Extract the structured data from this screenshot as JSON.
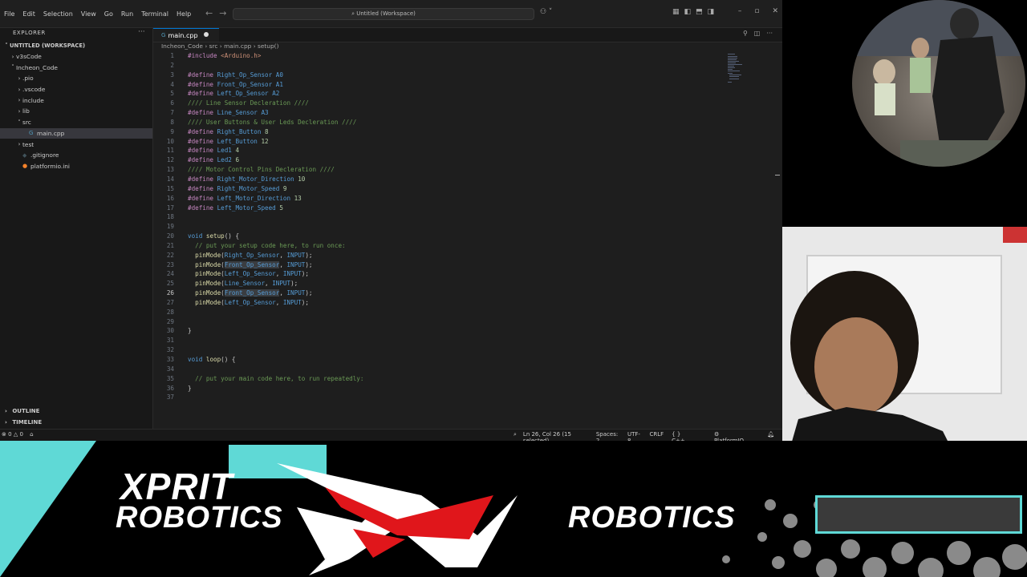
{
  "titlebar": {
    "menu": [
      "File",
      "Edit",
      "Selection",
      "View",
      "Go",
      "Run",
      "Terminal",
      "Help"
    ],
    "search_text": "Untitled (Workspace)"
  },
  "sidebar": {
    "header": "EXPLORER",
    "workspace": "UNTITLED (WORKSPACE)",
    "items": [
      {
        "label": "v3sCode",
        "depth": 1,
        "type": "folder"
      },
      {
        "label": "Incheon_Code",
        "depth": 1,
        "type": "folder-open"
      },
      {
        "label": ".pio",
        "depth": 2,
        "type": "folder"
      },
      {
        "label": ".vscode",
        "depth": 2,
        "type": "folder"
      },
      {
        "label": "include",
        "depth": 2,
        "type": "folder"
      },
      {
        "label": "lib",
        "depth": 2,
        "type": "folder"
      },
      {
        "label": "src",
        "depth": 2,
        "type": "folder-open"
      },
      {
        "label": "main.cpp",
        "depth": 3,
        "type": "cpp",
        "selected": true
      },
      {
        "label": "test",
        "depth": 2,
        "type": "folder"
      },
      {
        "label": ".gitignore",
        "depth": 2,
        "type": "git"
      },
      {
        "label": "platformio.ini",
        "depth": 2,
        "type": "pio"
      }
    ],
    "outline": "OUTLINE",
    "timeline": "TIMELINE"
  },
  "editor": {
    "tab_label": "main.cpp",
    "breadcrumb": [
      "Incheon_Code",
      "src",
      "main.cpp",
      "setup()"
    ],
    "active_line": 26,
    "lines": [
      "#include <Arduino.h>",
      "",
      "#define Right_Op_Sensor A0",
      "#define Front_Op_Sensor A1",
      "#define Left_Op_Sensor A2",
      "//// Line Sensor Decleration ////",
      "#define Line_Sensor A3",
      "//// User Buttons & User Leds Decleration ////",
      "#define Right_Button 8",
      "#define Left_Button 12",
      "#define Led1 4",
      "#define Led2 6",
      "//// Motor Control Pins Decleration ////",
      "#define Right_Motor_Direction 10",
      "#define Right_Motor_Speed 9",
      "#define Left_Motor_Direction 13",
      "#define Left_Motor_Speed 5",
      "",
      "",
      "void setup() {",
      "  // put your setup code here, to run once:",
      "  pinMode(Right_Op_Sensor, INPUT);",
      "  pinMode(Front_Op_Sensor, INPUT);",
      "  pinMode(Left_Op_Sensor, INPUT);",
      "  pinMode(Line_Sensor, INPUT);",
      "  pinMode(Front_Op_Sensor, INPUT);",
      "  pinMode(Left_Op_Sensor, INPUT);",
      "",
      "",
      "}",
      "",
      "",
      "void loop() {",
      "",
      "  // put your main code here, to run repeatedly:",
      "}",
      ""
    ]
  },
  "statusbar": {
    "problems": "0",
    "warnings": "0",
    "position": "Ln 26, Col 26 (15 selected)",
    "spaces": "Spaces: 2",
    "encoding": "UTF-8",
    "eol": "CRLF",
    "language": "C++",
    "platform": "PlatformIO"
  },
  "overlay": {
    "brand_line1": "XPRIT",
    "brand_line2": "ROBOTICS",
    "brand_right": "ROBOTICS",
    "accent": "#5fd9d6",
    "logo_red": "#e0161b"
  }
}
